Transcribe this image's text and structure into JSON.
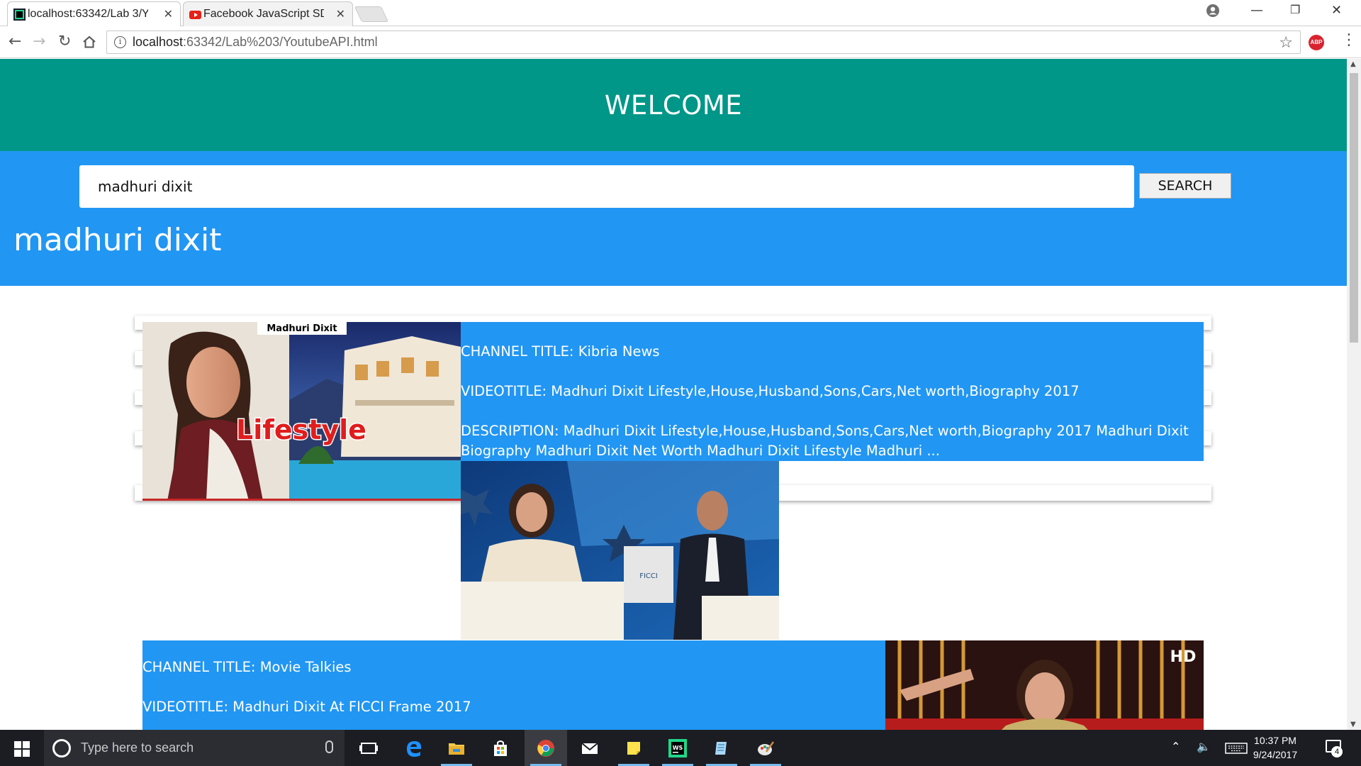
{
  "browser": {
    "tabs": [
      {
        "title": "localhost:63342/Lab 3/Yo"
      },
      {
        "title": "Facebook JavaScript SDK"
      }
    ],
    "address": {
      "host": "localhost",
      "rest": ":63342/Lab%203/YoutubeAPI.html"
    },
    "extension_badge": "ABP"
  },
  "page": {
    "welcome_title": "WELCOME",
    "search": {
      "value": "madhuri dixit",
      "button_label": "SEARCH"
    },
    "query_heading": "madhuri dixit",
    "results": [
      {
        "channel": "CHANNEL TITLE: Kibria News",
        "video_title": "VIDEOTITLE: Madhuri Dixit Lifestyle,House,Husband,Sons,Cars,Net worth,Biography 2017",
        "description": "DESCRIPTION: Madhuri Dixit Lifestyle,House,Husband,Sons,Cars,Net worth,Biography 2017 Madhuri Dixit Biography Madhuri Dixit Net Worth Madhuri Dixit Lifestyle Madhuri ...",
        "thumb_caption": "Madhuri Dixit",
        "thumb_overlay": "Lifestyle"
      },
      {
        "channel": "CHANNEL TITLE: Movie Talkies",
        "video_title": "VIDEOTITLE: Madhuri Dixit At FICCI Frame 2017",
        "thumb_badge": "HD"
      }
    ]
  },
  "taskbar": {
    "search_placeholder": "Type here to search",
    "time": "10:37 PM",
    "date": "9/24/2017",
    "notification_count": "4"
  }
}
